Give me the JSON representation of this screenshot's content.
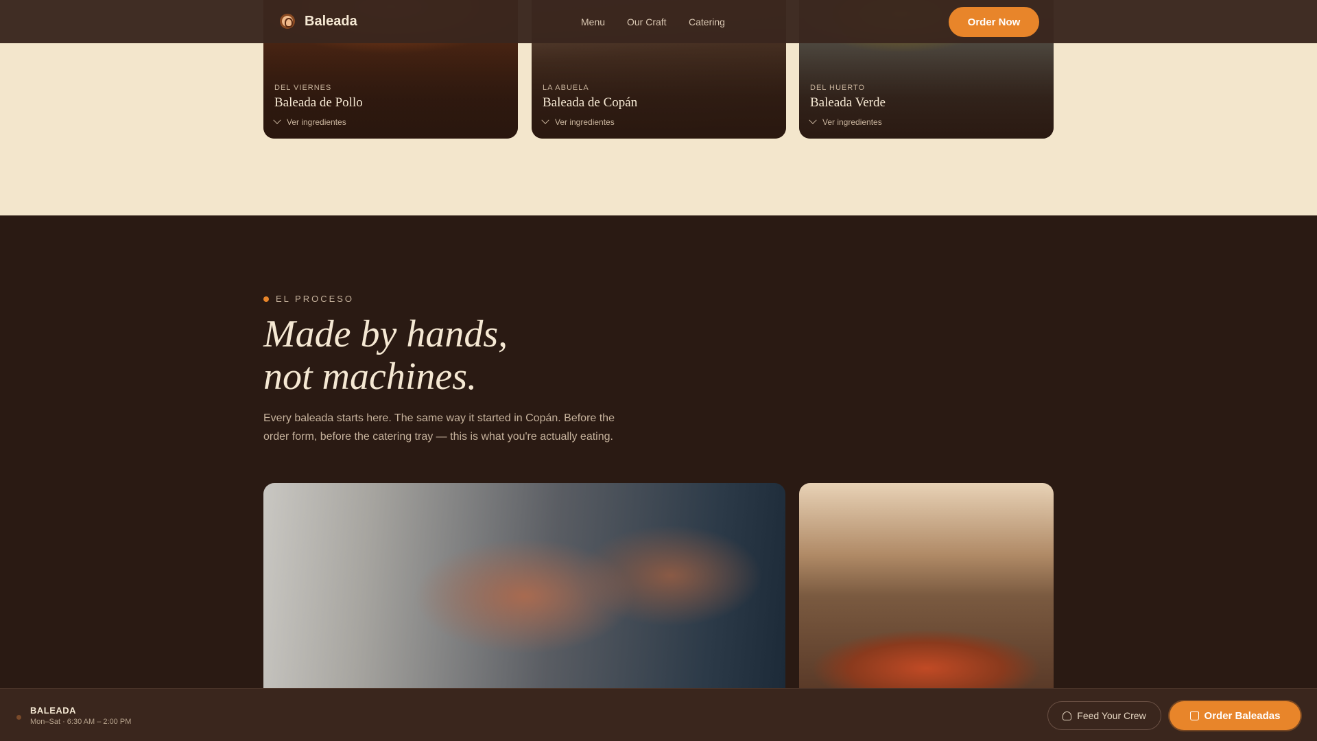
{
  "header": {
    "brand": "Baleada",
    "nav": [
      "Menu",
      "Our Craft",
      "Catering"
    ],
    "cta": "Order Now"
  },
  "cards": [
    {
      "tag": "DEL VIERNES",
      "name": "Baleada de Pollo",
      "more": "Ver ingredientes"
    },
    {
      "tag": "LA ABUELA",
      "name": "Baleada de Copán",
      "more": "Ver ingredientes"
    },
    {
      "tag": "DEL HUERTO",
      "name": "Baleada Verde",
      "more": "Ver ingredientes"
    }
  ],
  "process": {
    "eyebrow": "EL PROCESO",
    "headline_line1": "Made by hands,",
    "headline_line2": "not machines.",
    "intro": "Every baleada starts here. The same way it started in Copán. Before the order form, before the catering tray — this is what you're actually eating."
  },
  "bottom_bar": {
    "brand": "BALEADA",
    "hours": "Mon–Sat · 6:30 AM – 2:00 PM",
    "feed_label": "Feed Your Crew",
    "order_label": "Order Baleadas"
  },
  "colors": {
    "accent": "#e8852a",
    "dark_bg": "#2a1a13",
    "cream_bg": "#f3e6cc"
  }
}
